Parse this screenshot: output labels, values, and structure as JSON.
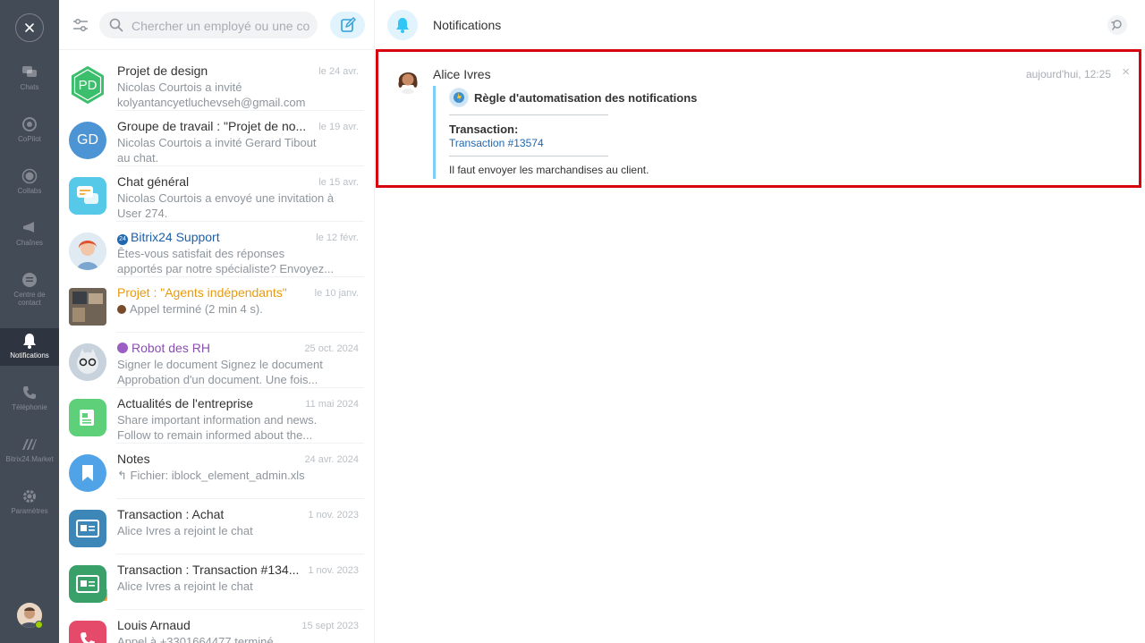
{
  "rail": {
    "items": [
      {
        "label": "Chats",
        "icon": "chat-icon"
      },
      {
        "label": "CoPilot",
        "icon": "copilot-icon"
      },
      {
        "label": "Collabs",
        "icon": "collabs-icon"
      },
      {
        "label": "Chaînes",
        "icon": "megaphone-icon"
      },
      {
        "label": "Centre de contact",
        "icon": "contact-center-icon"
      },
      {
        "label": "Notifications",
        "icon": "bell-icon"
      },
      {
        "label": "Téléphonie",
        "icon": "phone-icon"
      },
      {
        "label": "Bitrix24.Market",
        "icon": "market-icon"
      },
      {
        "label": "Paramètres",
        "icon": "gear-icon"
      }
    ]
  },
  "search": {
    "placeholder": "Chercher un employé ou une conve"
  },
  "chats": [
    {
      "title": "Projet de design",
      "date": "le 24 avr.",
      "line1": "Nicolas Courtois a invité",
      "line2": "kolyantancyetluchevseh@gmail.com",
      "avatar_text": "PD",
      "avatar_color": "#3bbf6c",
      "title_color": "#333333"
    },
    {
      "title": "Groupe de travail : \"Projet de no...",
      "date": "le 19 avr.",
      "line1": "Nicolas Courtois a invité Gerard Tibout",
      "line2": "au chat.",
      "avatar_text": "GD",
      "avatar_color": "#4c94d4",
      "title_color": "#333333"
    },
    {
      "title": "Chat général",
      "date": "le 15 avr.",
      "line1": "Nicolas Courtois a envoyé une invitation à",
      "line2": "User 274.",
      "avatar_text": "",
      "avatar_color": "#56c8e8",
      "title_color": "#333333"
    },
    {
      "title": "Bitrix24 Support",
      "date": "le 12 févr.",
      "line1": "Êtes-vous satisfait des réponses",
      "line2": "apportés par notre spécialiste? Envoyez...",
      "avatar_text": "",
      "avatar_color": "#d7e4f0",
      "title_color": "#1f5faa"
    },
    {
      "title": "Projet : \"Agents indépendants\"",
      "date": "le 10 janv.",
      "line1": "Appel terminé (2 min 4 s).",
      "line2": "",
      "avatar_text": "",
      "avatar_color": "#8a7b6a",
      "title_color": "#e89b10"
    },
    {
      "title": "Robot des RH",
      "date": "25 oct. 2024",
      "line1": "Signer le document Signez le document",
      "line2": "Approbation d'un document. Une fois...",
      "avatar_text": "",
      "avatar_color": "#c9d3dc",
      "title_color": "#8a4fb0"
    },
    {
      "title": "Actualités de l'entreprise",
      "date": "11 mai 2024",
      "line1": "Share important information and news.",
      "line2": "Follow to remain informed about the...",
      "avatar_text": "",
      "avatar_color": "#5fd07a",
      "title_color": "#333333"
    },
    {
      "title": "Notes",
      "date": "24 avr. 2024",
      "line1": "↰ Fichier: iblock_element_admin.xls",
      "line2": "",
      "avatar_text": "",
      "avatar_color": "#4fa3e6",
      "title_color": "#333333"
    },
    {
      "title": "Transaction : Achat",
      "date": "1 nov. 2023",
      "line1": "Alice Ivres a rejoint le chat",
      "line2": "",
      "avatar_text": "",
      "avatar_color": "#3d87b8",
      "title_color": "#333333"
    },
    {
      "title": "Transaction : Transaction #134...",
      "date": "1 nov. 2023",
      "line1": "Alice Ivres a rejoint le chat",
      "line2": "",
      "avatar_text": "",
      "avatar_color": "#3aa06a",
      "title_color": "#333333"
    },
    {
      "title": "Louis Arnaud",
      "date": "15 sept 2023",
      "line1": "Appel à +3301664477 terminé.",
      "line2": "",
      "avatar_text": "",
      "avatar_color": "#e64a6b",
      "title_color": "#333333"
    }
  ],
  "main": {
    "title": "Notifications",
    "notification": {
      "author": "Alice Ivres",
      "time": "aujourd'hui, 12:25",
      "close": "×",
      "bot_name": "Règle d'automatisation des notifications",
      "label": "Transaction:",
      "link": "Transaction #13574",
      "message": "Il faut envoyer les marchandises au client."
    }
  },
  "colors": {
    "highlight_border": "#d8040d",
    "accent": "#2fc6f6",
    "rail_bg": "#434b57"
  }
}
